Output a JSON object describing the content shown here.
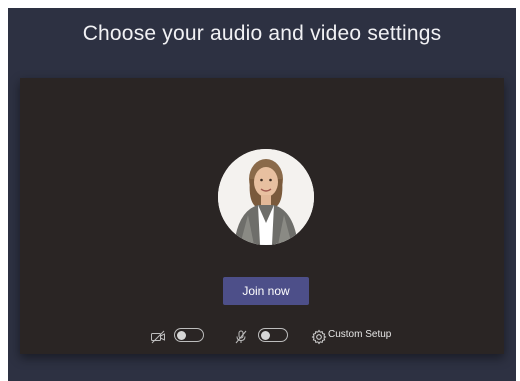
{
  "dialog": {
    "title": "Choose your audio and video settings"
  },
  "preview": {
    "avatar_icon": "user-portrait"
  },
  "actions": {
    "join_label": "Join now"
  },
  "controls": {
    "camera_icon": "camera-off-icon",
    "camera_enabled": false,
    "mic_icon": "microphone-off-icon",
    "mic_enabled": false,
    "settings_icon": "gear-icon",
    "custom_setup_label": "Custom Setup"
  },
  "colors": {
    "background": "#2d3142",
    "stage": "#2a2524",
    "join_button": "#4d4f89"
  }
}
